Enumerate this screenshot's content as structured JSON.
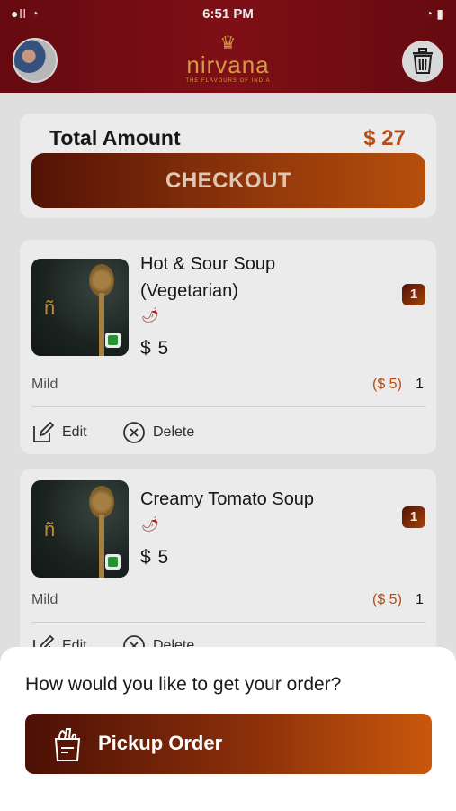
{
  "status_bar": {
    "carrier": "●ll ◔",
    "time": "6:51 PM",
    "battery": "◔ ▮"
  },
  "header": {
    "logo_crown": "♛",
    "logo_text": "nirvana",
    "logo_tagline": "THE FLAVOURS OF INDIA",
    "trash_icon": "trash-icon"
  },
  "summary": {
    "total_label": "Total Amount",
    "total_value": "$ 27",
    "checkout_label": "CHECKOUT"
  },
  "items": [
    {
      "name_line1": "Hot & Sour Soup",
      "name_line2": "(Vegetarian)",
      "price": "$ 5",
      "qty_badge": "1",
      "spice": "Mild",
      "line_price": "($ 5)",
      "line_qty": "1",
      "edit_label": "Edit",
      "delete_label": "Delete"
    },
    {
      "name_line1": "Creamy Tomato Soup",
      "name_line2": "",
      "price": "$ 5",
      "qty_badge": "1",
      "spice": "Mild",
      "line_price": "($ 5)",
      "line_qty": "1",
      "edit_label": "Edit",
      "delete_label": "Delete"
    }
  ],
  "sheet": {
    "question": "How would you like to get your order?",
    "pickup_label": "Pickup Order"
  },
  "colors": {
    "header_bg": "#7a0d14",
    "accent": "#c4551a",
    "gold": "#e4a84c",
    "veg_green": "#2ca03a"
  }
}
